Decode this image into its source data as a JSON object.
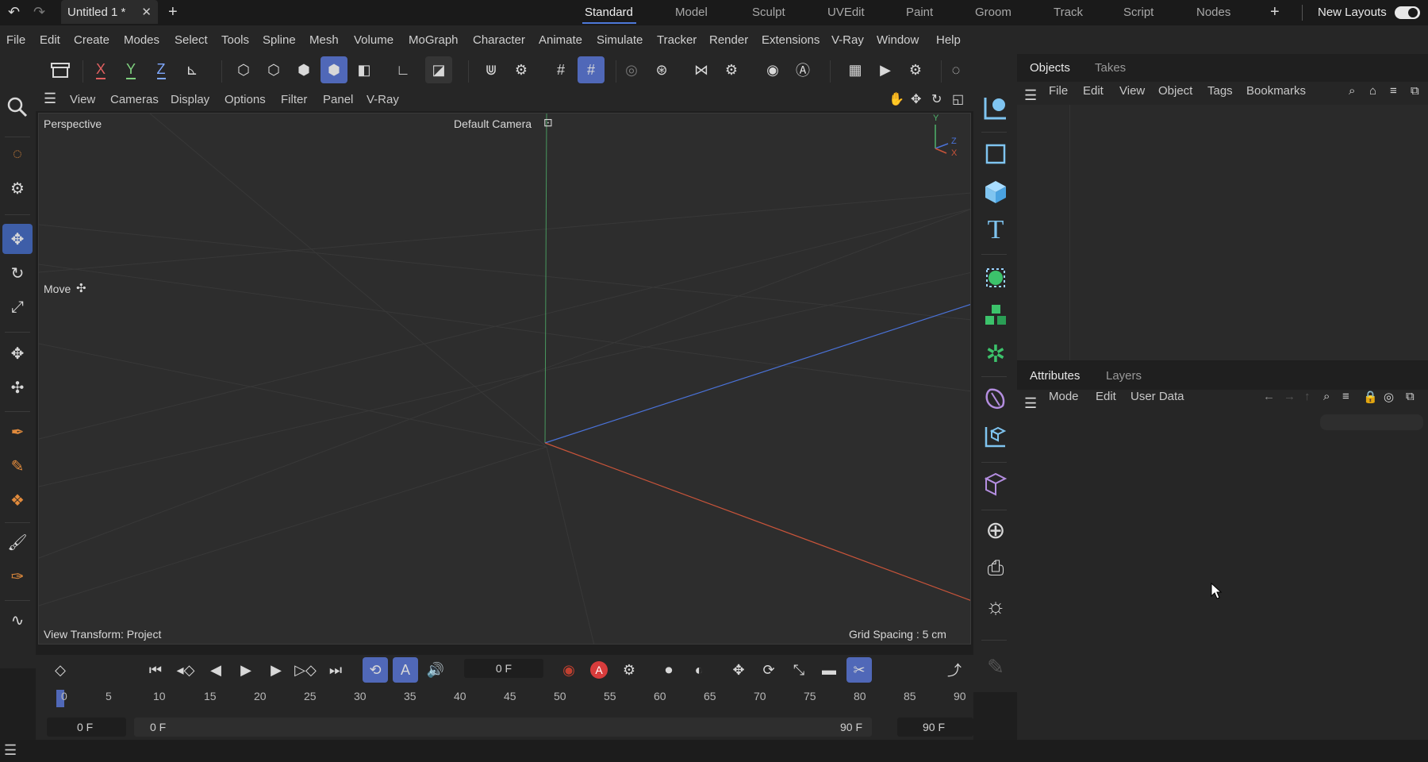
{
  "topbar": {
    "doc_tab": "Untitled 1 *",
    "layouts": [
      "Standard",
      "Model",
      "Sculpt",
      "UVEdit",
      "Paint",
      "Groom",
      "Track",
      "Script",
      "Nodes"
    ],
    "active_layout": "Standard",
    "new_layouts": "New Layouts"
  },
  "menubar": [
    "File",
    "Edit",
    "Create",
    "Modes",
    "Select",
    "Tools",
    "Spline",
    "Mesh",
    "Volume",
    "MoGraph",
    "Character",
    "Animate",
    "Simulate",
    "Tracker",
    "Render",
    "Extensions",
    "V-Ray",
    "Window",
    "Help"
  ],
  "toolbar": {
    "axis_x": "X",
    "axis_y": "Y",
    "axis_z": "Z"
  },
  "viewport_menu": [
    "View",
    "Cameras",
    "Display",
    "Options",
    "Filter",
    "Panel",
    "V-Ray"
  ],
  "viewport": {
    "projection": "Perspective",
    "camera": "Default Camera",
    "tool_hint": "Move",
    "view_transform": "View Transform: Project",
    "grid_spacing": "Grid Spacing : 5 cm",
    "axis_y": "Y",
    "axis_z": "Z",
    "axis_x": "X"
  },
  "objects_panel": {
    "tabs": [
      "Objects",
      "Takes"
    ],
    "menu": [
      "File",
      "Edit",
      "View",
      "Object",
      "Tags",
      "Bookmarks"
    ]
  },
  "attributes_panel": {
    "tabs": [
      "Attributes",
      "Layers"
    ],
    "menu": [
      "Mode",
      "Edit",
      "User Data"
    ]
  },
  "timeline": {
    "current_frame": "0 F",
    "ruler": [
      "0",
      "5",
      "10",
      "15",
      "20",
      "25",
      "30",
      "35",
      "40",
      "45",
      "50",
      "55",
      "60",
      "65",
      "70",
      "75",
      "80",
      "85",
      "90"
    ],
    "start_field": "0 F",
    "range_start": "0 F",
    "range_end": "90 F",
    "end_field": "90 F"
  },
  "colors": {
    "accent": "#5068b8",
    "axis_x": "#c8543a",
    "axis_y": "#4fb36b",
    "axis_z": "#4a72d8",
    "icon_blue": "#7fc4f0",
    "icon_green": "#3cc26b",
    "icon_purple": "#b48ee0"
  }
}
